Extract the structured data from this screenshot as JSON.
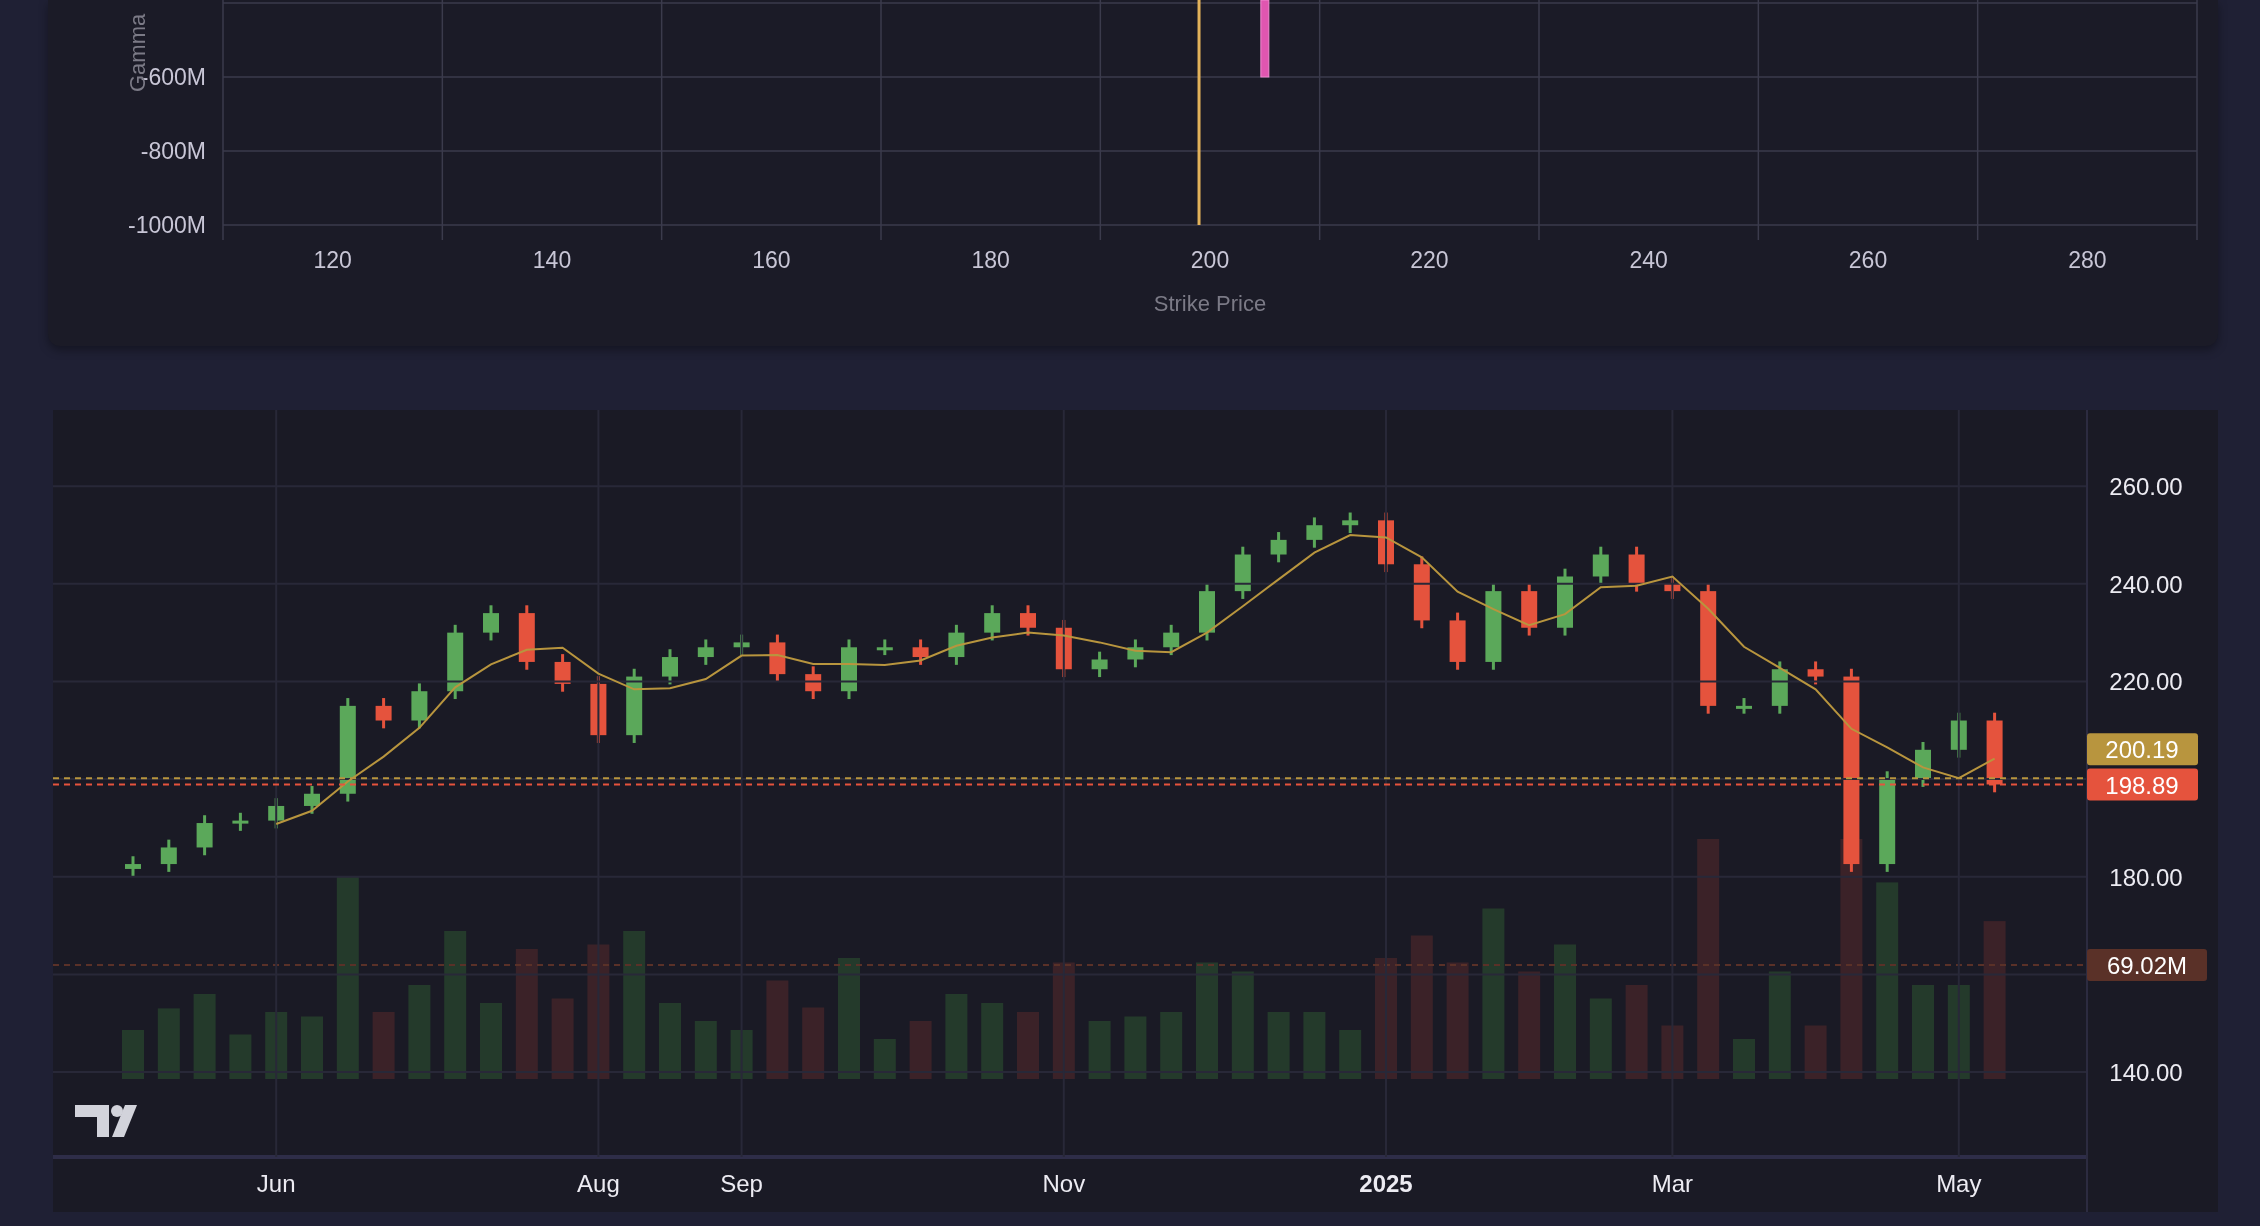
{
  "gamma_chart": {
    "chart_data": {
      "type": "bar",
      "xlabel": "Strike Price",
      "ylabel": "Gamma",
      "grid": true,
      "x": [
        205
      ],
      "series": [
        {
          "values": [
            -600
          ]
        }
      ],
      "xlim": [
        110,
        290
      ],
      "ylim": [
        -1000,
        -392
      ],
      "xticks": [
        120,
        140,
        160,
        180,
        200,
        220,
        240,
        260,
        280
      ],
      "yticks": [
        {
          "value": -600,
          "label": "-600M"
        },
        {
          "value": -800,
          "label": "-800M"
        },
        {
          "value": -1000,
          "label": "-1000M"
        }
      ],
      "ref_lines": [
        {
          "axis": "x",
          "value": 199,
          "color": "#e2b25a"
        }
      ]
    }
  },
  "price_chart": {
    "chart_data": {
      "type": "line",
      "grid": true,
      "categories": [
        null,
        null,
        null,
        null,
        "Jun",
        null,
        null,
        null,
        null,
        null,
        null,
        null,
        null,
        "Aug",
        null,
        null,
        null,
        "Sep",
        null,
        null,
        null,
        null,
        null,
        null,
        null,
        null,
        "Nov",
        null,
        null,
        null,
        null,
        null,
        null,
        null,
        null,
        "2025",
        null,
        null,
        null,
        null,
        null,
        null,
        null,
        "Mar",
        null,
        null,
        null,
        null,
        null,
        null,
        null,
        "May",
        null
      ],
      "series": [
        {
          "color": "#b8953e",
          "values": [
            null,
            null,
            null,
            null,
            190.8,
            193.5,
            199.5,
            204.6,
            210.5,
            218.8,
            223.5,
            226.5,
            226.9,
            221.6,
            218.4,
            218.6,
            220.5,
            225.3,
            225.4,
            223.6,
            223.6,
            223.4,
            224.3,
            227.3,
            229,
            230,
            229.4,
            228,
            226.3,
            226,
            230,
            235.4,
            240.9,
            246.4,
            250,
            249.5,
            245.4,
            238.4,
            234.8,
            231.5,
            233.8,
            239.3,
            239.6,
            241.5,
            234.9,
            227.1,
            222.8,
            218.4,
            210.3,
            206.5,
            202.4,
            200.2,
            204.2
          ]
        }
      ],
      "ylim": [
        122.6,
        275.6
      ],
      "yticks": [
        {
          "value": 260,
          "label": "260.00"
        },
        {
          "value": 240,
          "label": "240.00"
        },
        {
          "value": 220,
          "label": "220.00"
        },
        {
          "value": 180,
          "label": "180.00"
        },
        {
          "value": 140,
          "label": "140.00"
        }
      ],
      "ref_lines": [
        {
          "axis": "y",
          "value": 200.19,
          "label": "200.19",
          "color": "#b8953e"
        },
        {
          "axis": "y",
          "value": 198.89,
          "label": "198.89",
          "color": "#e5533d"
        }
      ]
    },
    "volume_tag": {
      "label": "69.02M",
      "color": "#5a3128"
    }
  }
}
